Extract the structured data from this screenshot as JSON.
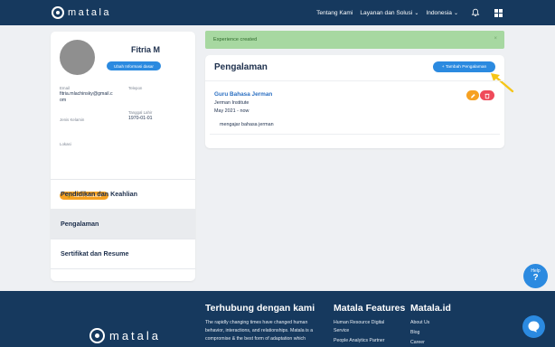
{
  "nav": {
    "brand": "matala",
    "links": [
      {
        "label": "Tentang Kami"
      },
      {
        "label": "Layanan dan Solusi",
        "chevron": "⌄"
      },
      {
        "label": "Indonesia",
        "chevron": "⌄"
      }
    ],
    "icons": [
      "bell-icon",
      "apps-grid-icon"
    ]
  },
  "profile": {
    "name": "Fitria M",
    "edit_button": "Ubah Informasi dasar",
    "email_label": "Email",
    "email_line1": "fitria.mlachinsky@gmail.c",
    "email_line2": "om",
    "phone_label": "Telepon",
    "gender_label": "Jenis Kelamin",
    "birth_label": "Tanggal Lahir",
    "birth_value": "1970-01-01",
    "location_label": "Lokasi",
    "password_button": "Ganti Password"
  },
  "side_menu": {
    "items": [
      {
        "label": "Pendidikan dan Keahlian",
        "active": false
      },
      {
        "label": "Pengalaman",
        "active": true
      },
      {
        "label": "Sertifikat dan Resume",
        "active": false
      }
    ]
  },
  "alert": {
    "message": "Experience created",
    "close": "×"
  },
  "experience": {
    "title": "Pengalaman",
    "add_button": "+ Tambah Pengalaman",
    "entries": [
      {
        "position": "Guru Bahasa Jerman",
        "company": "Jerman Institute",
        "period": "May 2021 - now",
        "description": "mengajar bahasa jerman"
      }
    ]
  },
  "help": {
    "label": "Help",
    "symbol": "?"
  },
  "footer": {
    "brand": "matala",
    "contact_heading": "Terhubung dengan kami",
    "contact_line1": "The rapidly changing times have changed human",
    "contact_line2": "behavior, interactions, and relationships. Matala is a",
    "contact_line3": "compromise & the best form of adaptation which",
    "features_heading": "Matala Features",
    "features": [
      "Human Resource Digital",
      "Service",
      "People Analytics Partner"
    ],
    "site_heading": "Matala.id",
    "site_links": [
      "About Us",
      "Blog",
      "Career"
    ]
  },
  "colors": {
    "navy": "#16395e",
    "primary": "#2b8ae0",
    "orange": "#f6a122",
    "danger": "#ef4a5a",
    "success_bg": "#a7d8a1",
    "arrow": "#f5c518"
  }
}
